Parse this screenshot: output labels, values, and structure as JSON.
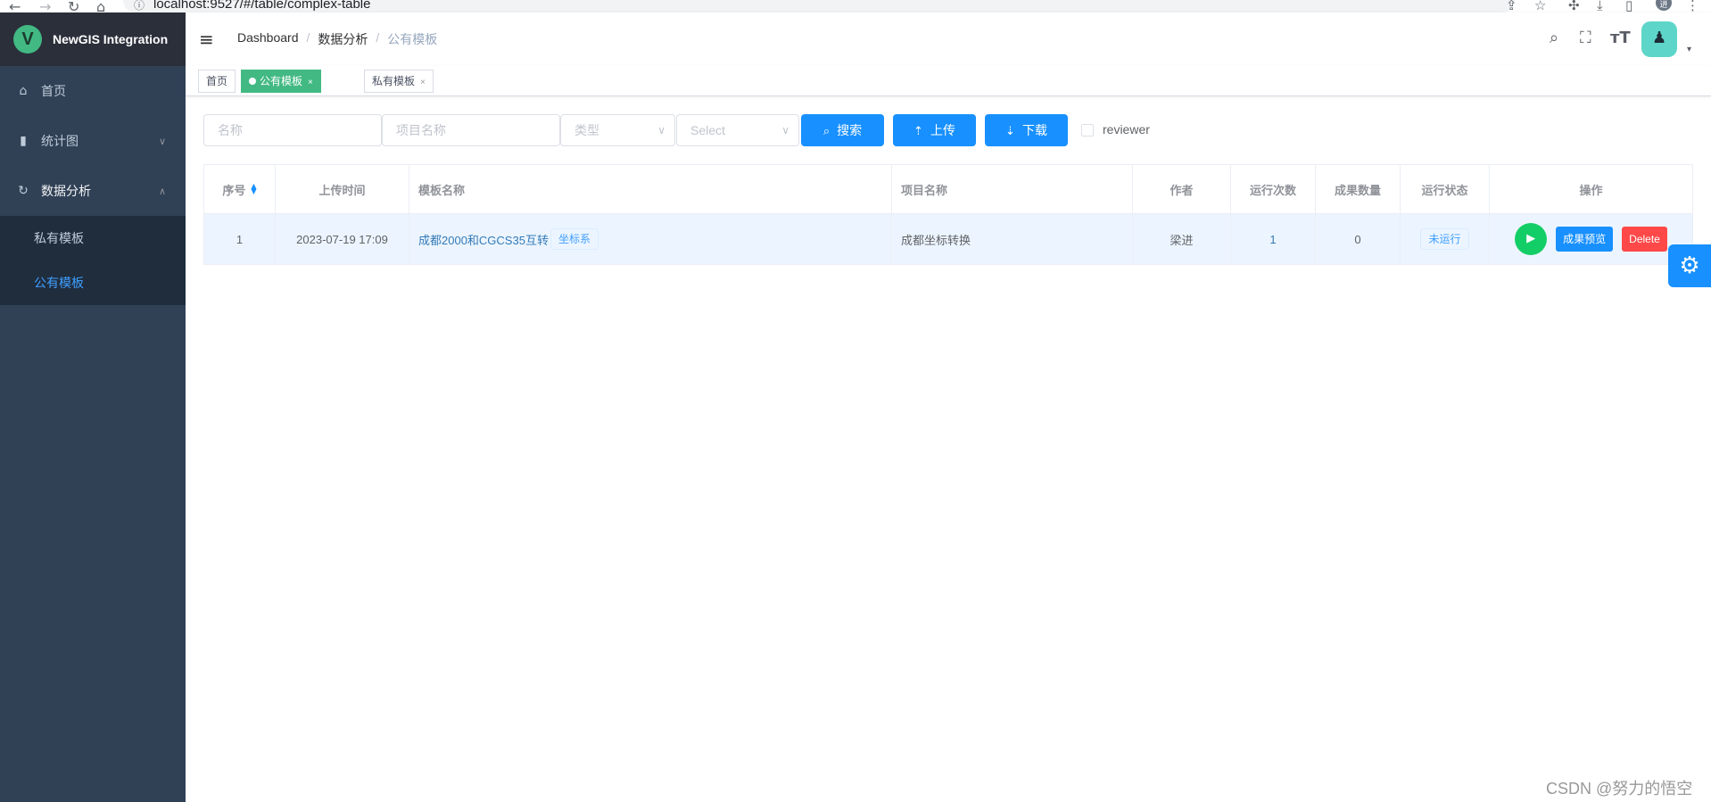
{
  "browser": {
    "url": "localhost:9527/#/table/complex-table",
    "avatar": "进"
  },
  "sidebar": {
    "title": "NewGIS Integration",
    "logo_letter": "V",
    "items": [
      {
        "label": "首页",
        "icon": "home-icon"
      },
      {
        "label": "统计图",
        "icon": "bar-chart-icon"
      },
      {
        "label": "数据分析",
        "icon": "refresh-icon"
      }
    ],
    "submenu": [
      {
        "label": "私有模板"
      },
      {
        "label": "公有模板"
      }
    ]
  },
  "navbar": {
    "breadcrumb": [
      "Dashboard",
      "数据分析",
      "公有模板"
    ]
  },
  "tags": [
    {
      "label": "首页"
    },
    {
      "label": "公有模板"
    },
    {
      "label": "私有模板"
    }
  ],
  "filters": {
    "name_placeholder": "名称",
    "project_placeholder": "项目名称",
    "type_placeholder": "类型",
    "select_placeholder": "Select",
    "search_label": "搜索",
    "upload_label": "上传",
    "download_label": "下载",
    "reviewer_label": "reviewer"
  },
  "table": {
    "headers": [
      "序号",
      "上传时间",
      "模板名称",
      "项目名称",
      "作者",
      "运行次数",
      "成果数量",
      "运行状态",
      "操作"
    ],
    "rows": [
      {
        "id": "1",
        "time": "2023-07-19 17:09",
        "template": "成都2000和CGCS35互转",
        "template_tag": "坐标系",
        "project": "成都坐标转换",
        "author": "梁进",
        "runs": "1",
        "results": "0",
        "status": "未运行",
        "preview_label": "成果预览",
        "delete_label": "Delete"
      }
    ]
  },
  "watermark": "CSDN @努力的悟空",
  "colors": {
    "sidebar_bg": "#304156",
    "primary": "#1890ff",
    "active_tag": "#42b983",
    "success": "#13ce66",
    "danger": "#ff4949"
  }
}
